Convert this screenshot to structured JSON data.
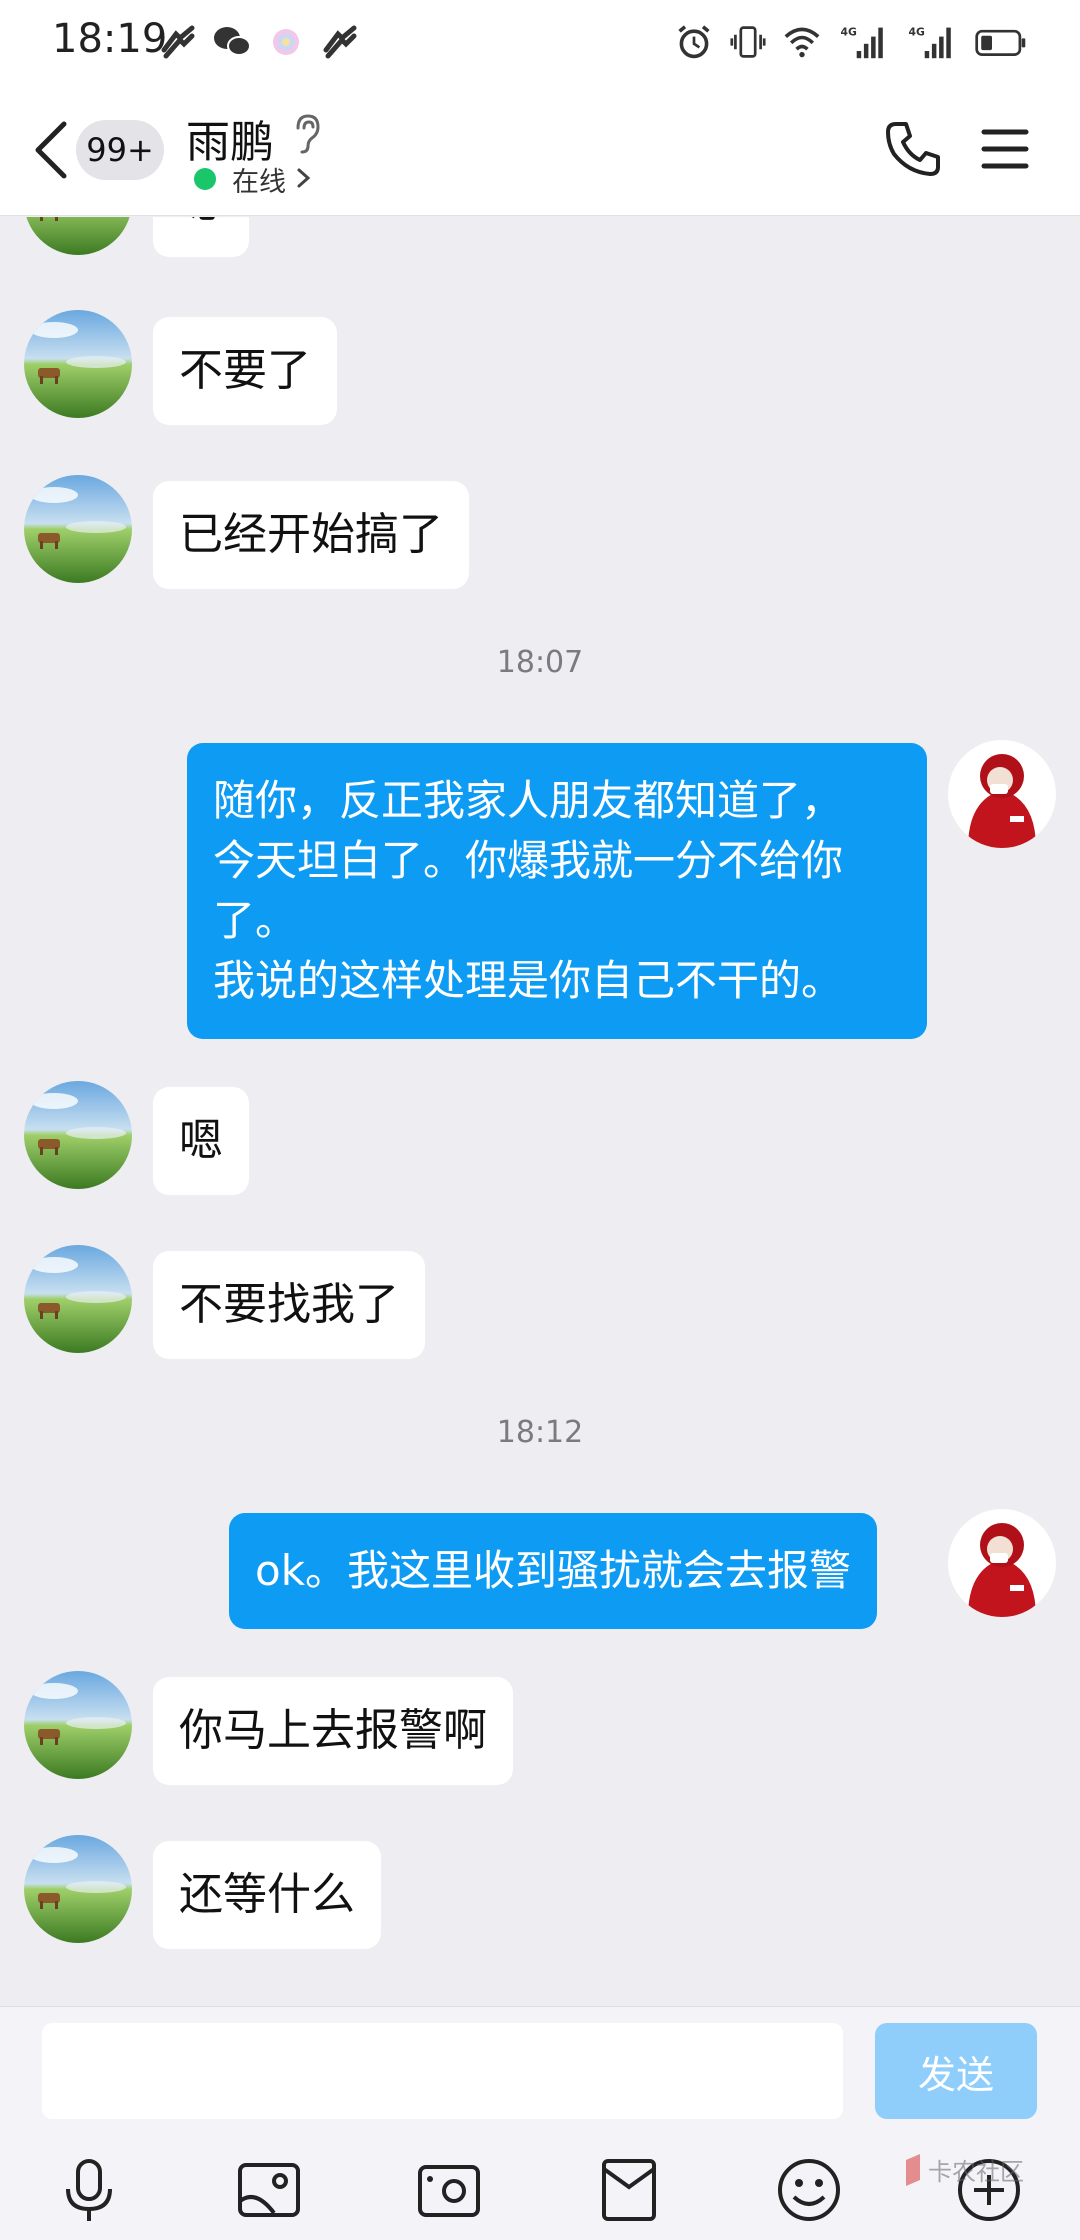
{
  "status_bar": {
    "time": "18:19",
    "left_icons": [
      "tiktok-icon",
      "wechat-icon",
      "color-ring-icon",
      "tiktok-icon"
    ],
    "right_icons": [
      "alarm-icon",
      "vibrate-icon",
      "wifi-icon",
      "signal-4g-icon",
      "signal-4g-icon",
      "battery-icon"
    ],
    "network_label": "4G"
  },
  "header": {
    "unread_count": "99+",
    "contact_name": "雨鹏",
    "status": "在线"
  },
  "messages": [
    {
      "side": "in",
      "text": "嗯"
    },
    {
      "side": "in",
      "text": "不要了"
    },
    {
      "side": "in",
      "text": "已经开始搞了"
    },
    {
      "type": "time",
      "text": "18:07"
    },
    {
      "side": "out",
      "lines": [
        "随你，反正我家人朋友都知道了，",
        "今天坦白了。你爆我就一分不给你",
        "了。",
        "我说的这样处理是你自己不干的。"
      ]
    },
    {
      "side": "in",
      "text": "嗯"
    },
    {
      "side": "in",
      "text": "不要找我了"
    },
    {
      "type": "time",
      "text": "18:12"
    },
    {
      "side": "out",
      "text": "ok。我这里收到骚扰就会去报警"
    },
    {
      "side": "in",
      "text": "你马上去报警啊"
    },
    {
      "side": "in",
      "text": "还等什么"
    }
  ],
  "composer": {
    "input_value": "",
    "send_label": "发送",
    "tools": [
      "microphone-icon",
      "image-icon",
      "camera-icon",
      "red-packet-icon",
      "emoji-icon",
      "plus-icon"
    ]
  },
  "watermark": "卡农社区",
  "colors": {
    "background": "#ededf2",
    "outgoing_bubble": "#0e9bf4",
    "incoming_bubble": "#ffffff",
    "send_button": "#8fcdfb",
    "online": "#19c76a"
  }
}
